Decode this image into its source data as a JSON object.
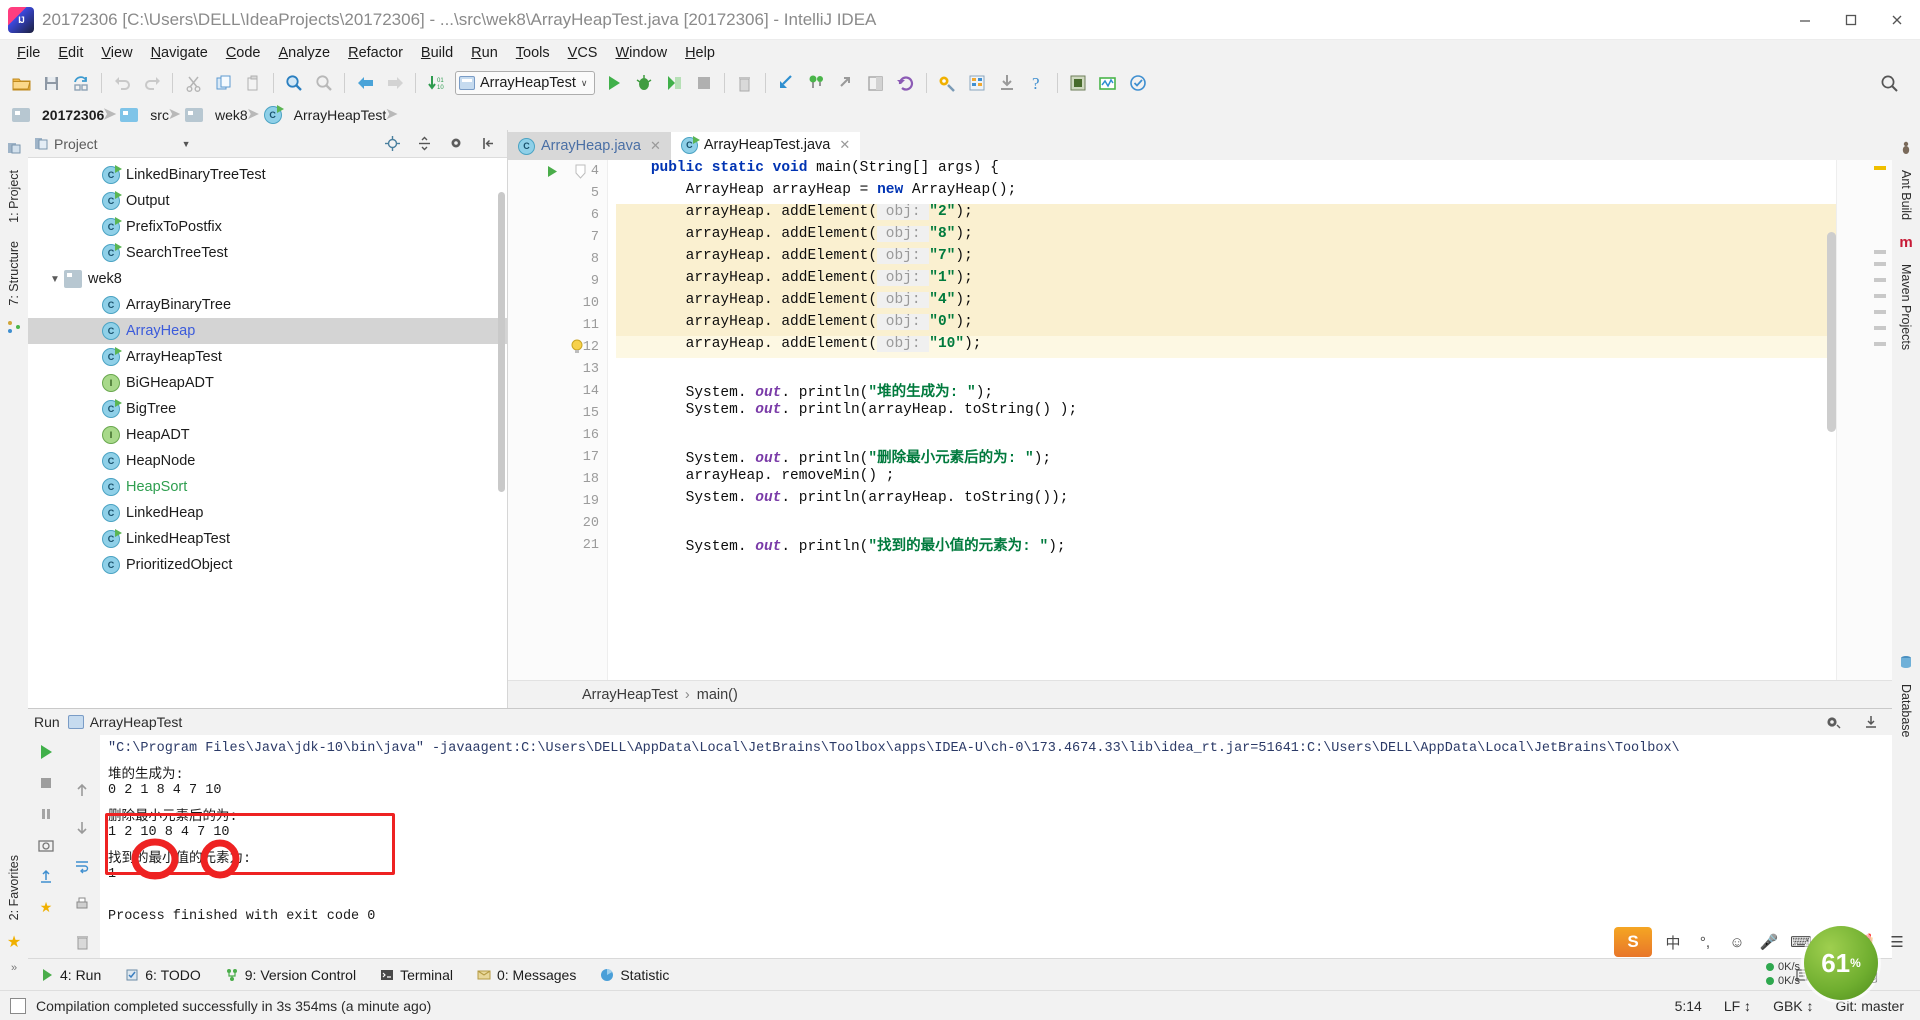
{
  "window": {
    "title": "20172306 [C:\\Users\\DELL\\IdeaProjects\\20172306] - ...\\src\\wek8\\ArrayHeapTest.java [20172306] - IntelliJ IDEA",
    "minimize": "—",
    "maximize": "❐",
    "close": "✕"
  },
  "menu": [
    "File",
    "Edit",
    "View",
    "Navigate",
    "Code",
    "Analyze",
    "Refactor",
    "Build",
    "Run",
    "Tools",
    "VCS",
    "Window",
    "Help"
  ],
  "toolbar": {
    "run_config": "ArrayHeapTest",
    "caret": "∨",
    "icons": [
      "open-folder-icon",
      "save-all-icon",
      "sync-icon",
      "undo-icon",
      "redo-icon",
      "cut-icon",
      "copy-icon",
      "paste-icon",
      "find-icon",
      "replace-icon",
      "back-icon",
      "forward-icon",
      "compile-icon",
      "run-icon",
      "debug-icon",
      "run-coverage-icon",
      "stop-icon",
      "trash-icon",
      "step-into-icon",
      "profiler-icon",
      "step-out-icon",
      "layout-icon",
      "rollback-icon",
      "settings-icon",
      "project-structure-icon",
      "update-icon",
      "help-icon",
      "database-icon",
      "chart-icon",
      "check-icon",
      "search-everywhere-icon"
    ]
  },
  "breadcrumb": [
    {
      "label": "20172306",
      "icon": "module-icon"
    },
    {
      "label": "src",
      "icon": "folder-blue-icon"
    },
    {
      "label": "wek8",
      "icon": "folder-icon"
    },
    {
      "label": "ArrayHeapTest",
      "icon": "class-run-icon"
    }
  ],
  "left_rail": [
    "1: Project",
    "7: Structure",
    "2: Favorites"
  ],
  "right_rail": [
    "Ant Build",
    "Maven Projects",
    "Database"
  ],
  "project_panel": {
    "title": "Project",
    "tree": [
      {
        "label": "LinkedBinaryTreeTest",
        "icon": "class-run-icon",
        "indent": 3,
        "selected": false,
        "color": ""
      },
      {
        "label": "Output",
        "icon": "class-run-icon",
        "indent": 3,
        "selected": false,
        "color": ""
      },
      {
        "label": "PrefixToPostfix",
        "icon": "class-run-icon",
        "indent": 3,
        "selected": false,
        "color": ""
      },
      {
        "label": "SearchTreeTest",
        "icon": "class-run-icon",
        "indent": 3,
        "selected": false,
        "color": ""
      },
      {
        "label": "wek8",
        "icon": "folder-icon",
        "indent": 2,
        "selected": false,
        "color": "",
        "expanded": true
      },
      {
        "label": "ArrayBinaryTree",
        "icon": "class-icon",
        "indent": 3,
        "selected": false,
        "color": ""
      },
      {
        "label": "ArrayHeap",
        "icon": "class-icon",
        "indent": 3,
        "selected": true,
        "color": "blue"
      },
      {
        "label": "ArrayHeapTest",
        "icon": "class-run-icon",
        "indent": 3,
        "selected": false,
        "color": ""
      },
      {
        "label": "BiGHeapADT",
        "icon": "interface-icon",
        "indent": 3,
        "selected": false,
        "color": ""
      },
      {
        "label": "BigTree",
        "icon": "class-run-icon",
        "indent": 3,
        "selected": false,
        "color": ""
      },
      {
        "label": "HeapADT",
        "icon": "interface-icon",
        "indent": 3,
        "selected": false,
        "color": ""
      },
      {
        "label": "HeapNode",
        "icon": "class-icon",
        "indent": 3,
        "selected": false,
        "color": ""
      },
      {
        "label": "HeapSort",
        "icon": "class-icon",
        "indent": 3,
        "selected": false,
        "color": "green"
      },
      {
        "label": "LinkedHeap",
        "icon": "class-icon",
        "indent": 3,
        "selected": false,
        "color": ""
      },
      {
        "label": "LinkedHeapTest",
        "icon": "class-run-icon",
        "indent": 3,
        "selected": false,
        "color": ""
      },
      {
        "label": "PrioritizedObject",
        "icon": "class-icon",
        "indent": 3,
        "selected": false,
        "color": ""
      }
    ]
  },
  "editor": {
    "tabs": [
      {
        "label": "ArrayHeap.java",
        "active": false,
        "icon": "class-icon"
      },
      {
        "label": "ArrayHeapTest.java",
        "active": true,
        "icon": "class-run-icon"
      }
    ],
    "first_line_number": 4,
    "lines": [
      {
        "n": 4,
        "indent": 4,
        "highlight": "none",
        "segments": [
          {
            "t": "public static ",
            "c": "kw"
          },
          {
            "t": "void ",
            "c": "kw"
          },
          {
            "t": "main(String[] args) {",
            "c": ""
          }
        ]
      },
      {
        "n": 5,
        "indent": 8,
        "highlight": "none",
        "segments": [
          {
            "t": "ArrayHeap arrayHeap = ",
            "c": ""
          },
          {
            "t": "new ",
            "c": "kw"
          },
          {
            "t": "ArrayHeap();",
            "c": ""
          }
        ]
      },
      {
        "n": 6,
        "indent": 8,
        "highlight": "hl",
        "segments": [
          {
            "t": "arrayHeap. addElement(",
            "c": ""
          },
          {
            "t": " obj: ",
            "c": "hint"
          },
          {
            "t": "\"2\"",
            "c": "str"
          },
          {
            "t": ");",
            "c": ""
          }
        ]
      },
      {
        "n": 7,
        "indent": 8,
        "highlight": "hl",
        "segments": [
          {
            "t": "arrayHeap. addElement(",
            "c": ""
          },
          {
            "t": " obj: ",
            "c": "hint"
          },
          {
            "t": "\"8\"",
            "c": "str"
          },
          {
            "t": ");",
            "c": ""
          }
        ]
      },
      {
        "n": 8,
        "indent": 8,
        "highlight": "hl",
        "segments": [
          {
            "t": "arrayHeap. addElement(",
            "c": ""
          },
          {
            "t": " obj: ",
            "c": "hint"
          },
          {
            "t": "\"7\"",
            "c": "str"
          },
          {
            "t": ");",
            "c": ""
          }
        ]
      },
      {
        "n": 9,
        "indent": 8,
        "highlight": "hl",
        "segments": [
          {
            "t": "arrayHeap. addElement(",
            "c": ""
          },
          {
            "t": " obj: ",
            "c": "hint"
          },
          {
            "t": "\"1\"",
            "c": "str"
          },
          {
            "t": ");",
            "c": ""
          }
        ]
      },
      {
        "n": 10,
        "indent": 8,
        "highlight": "hl",
        "segments": [
          {
            "t": "arrayHeap. addElement(",
            "c": ""
          },
          {
            "t": " obj: ",
            "c": "hint"
          },
          {
            "t": "\"4\"",
            "c": "str"
          },
          {
            "t": ");",
            "c": ""
          }
        ]
      },
      {
        "n": 11,
        "indent": 8,
        "highlight": "hl",
        "segments": [
          {
            "t": "arrayHeap. addElement(",
            "c": ""
          },
          {
            "t": " obj: ",
            "c": "hint"
          },
          {
            "t": "\"0\"",
            "c": "str"
          },
          {
            "t": ");",
            "c": ""
          }
        ]
      },
      {
        "n": 12,
        "indent": 8,
        "highlight": "hl2",
        "segments": [
          {
            "t": "arrayHeap. addElement(",
            "c": ""
          },
          {
            "t": " obj: ",
            "c": "hint"
          },
          {
            "t": "\"10\"",
            "c": "str"
          },
          {
            "t": ");",
            "c": ""
          }
        ]
      },
      {
        "n": 13,
        "indent": 0,
        "highlight": "none",
        "segments": []
      },
      {
        "n": 14,
        "indent": 8,
        "highlight": "none",
        "segments": [
          {
            "t": "System. ",
            "c": ""
          },
          {
            "t": "out",
            "c": "fld"
          },
          {
            "t": ". println(",
            "c": ""
          },
          {
            "t": "\"堆的生成为: \"",
            "c": "str"
          },
          {
            "t": ");",
            "c": ""
          }
        ]
      },
      {
        "n": 15,
        "indent": 8,
        "highlight": "none",
        "segments": [
          {
            "t": "System. ",
            "c": ""
          },
          {
            "t": "out",
            "c": "fld"
          },
          {
            "t": ". println(arrayHeap. toString() );",
            "c": ""
          }
        ]
      },
      {
        "n": 16,
        "indent": 0,
        "highlight": "none",
        "segments": []
      },
      {
        "n": 17,
        "indent": 8,
        "highlight": "none",
        "segments": [
          {
            "t": "System. ",
            "c": ""
          },
          {
            "t": "out",
            "c": "fld"
          },
          {
            "t": ". println(",
            "c": ""
          },
          {
            "t": "\"删除最小元素后的为: \"",
            "c": "str"
          },
          {
            "t": ");",
            "c": ""
          }
        ]
      },
      {
        "n": 18,
        "indent": 8,
        "highlight": "none",
        "segments": [
          {
            "t": "arrayHeap. removeMin() ;",
            "c": ""
          }
        ]
      },
      {
        "n": 19,
        "indent": 8,
        "highlight": "none",
        "segments": [
          {
            "t": "System. ",
            "c": ""
          },
          {
            "t": "out",
            "c": "fld"
          },
          {
            "t": ". println(arrayHeap. toString());",
            "c": ""
          }
        ]
      },
      {
        "n": 20,
        "indent": 0,
        "highlight": "none",
        "segments": []
      },
      {
        "n": 21,
        "indent": 8,
        "highlight": "none",
        "segments": [
          {
            "t": "System. ",
            "c": ""
          },
          {
            "t": "out",
            "c": "fld"
          },
          {
            "t": ". println(",
            "c": ""
          },
          {
            "t": "\"找到的最小值的元素为: \"",
            "c": "str"
          },
          {
            "t": ");",
            "c": ""
          }
        ]
      }
    ],
    "gutter_markers": {
      "run_arrow_line": 4,
      "bulb_line": 12,
      "fold_line": 4
    },
    "breadcrumb": [
      "ArrayHeapTest",
      "main()"
    ]
  },
  "run_panel": {
    "header_label": "Run",
    "header_config": "ArrayHeapTest",
    "console_lines": [
      {
        "text": "\"C:\\Program Files\\Java\\jdk-10\\bin\\java\" -javaagent:C:\\Users\\DELL\\AppData\\Local\\JetBrains\\Toolbox\\apps\\IDEA-U\\ch-0\\173.4674.33\\lib\\idea_rt.jar=51641:C:\\Users\\DELL\\AppData\\Local\\JetBrains\\Toolbox\\",
        "type": "cmd"
      },
      {
        "text": "堆的生成为:",
        "type": "out"
      },
      {
        "text": "0 2 1 8 4 7 10",
        "type": "out"
      },
      {
        "text": "删除最小元素后的为:",
        "type": "out"
      },
      {
        "text": "1 2 10 8 4 7 10",
        "type": "out"
      },
      {
        "text": "找到的最小值的元素为:",
        "type": "out"
      },
      {
        "text": "1",
        "type": "out"
      },
      {
        "text": "",
        "type": "out"
      },
      {
        "text": "Process finished with exit code 0",
        "type": "fin"
      }
    ],
    "annotation_color": "#ee2222"
  },
  "status_tabs": [
    {
      "label": "4: Run",
      "icon": "run-icon"
    },
    {
      "label": "6: TODO",
      "icon": "todo-icon"
    },
    {
      "label": "9: Version Control",
      "icon": "vcs-icon"
    },
    {
      "label": "Terminal",
      "icon": "terminal-icon"
    },
    {
      "label": "0: Messages",
      "icon": "messages-icon"
    },
    {
      "label": "Statistic",
      "icon": "statistic-icon"
    }
  ],
  "status_right": {
    "event_log": "Event Log",
    "caret_pos": "5:14",
    "line_sep": "LF",
    "encoding": "GBK",
    "branch": "Git: master"
  },
  "bottom_bar": {
    "message": "Compilation completed successfully in 3s 354ms (a minute ago)"
  },
  "tray": {
    "ime_label": "中",
    "speed_up": "0K/s",
    "speed_down": "0K/s",
    "badge_value": "61",
    "badge_unit": "%"
  }
}
